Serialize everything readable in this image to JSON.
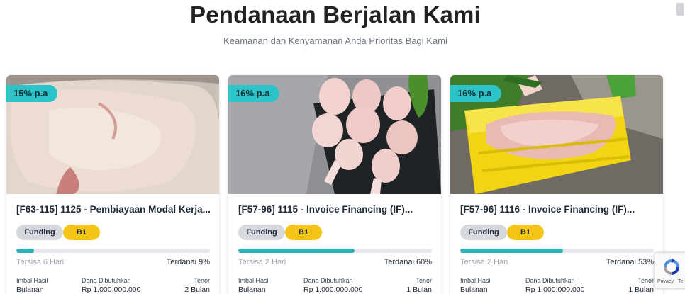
{
  "header": {
    "title": "Pendanaan Berjalan Kami",
    "subtitle": "Keamanan dan Kenyamanan Anda Prioritas Bagi Kami"
  },
  "cards": [
    {
      "rate": "15% p.a",
      "title": "[F63-115] 1125 - Pembiayaan Modal Kerja...",
      "tag_funding": "Funding",
      "tag_grade": "B1",
      "progress_percent": 9,
      "remaining": "Tersisa 6 Hari",
      "funded": "Terdanai 9%",
      "label_return": "Imbal Hasil",
      "label_needed": "Dana Dibutuhkan",
      "label_tenor": "Tenor",
      "return_value": "Bulanan",
      "needed_value": "Rp 1.000.000.000",
      "tenor_value": "2 Bulan"
    },
    {
      "rate": "16% p.a",
      "title": "[F57-96] 1115 - Invoice Financing (IF)...",
      "tag_funding": "Funding",
      "tag_grade": "B1",
      "progress_percent": 60,
      "remaining": "Tersisa 2 Hari",
      "funded": "Terdanai 60%",
      "label_return": "Imbal Hasil",
      "label_needed": "Dana Dibutuhkan",
      "label_tenor": "Tenor",
      "return_value": "Bulanan",
      "needed_value": "Rp 1.000.000.000",
      "tenor_value": "1 Bulan"
    },
    {
      "rate": "16% p.a",
      "title": "[F57-96] 1116 - Invoice Financing (IF)...",
      "tag_funding": "Funding",
      "tag_grade": "B1",
      "progress_percent": 53,
      "remaining": "Tersisa 2 Hari",
      "funded": "Terdanai 53%",
      "label_return": "Imbal Hasil",
      "label_needed": "Dana Dibutuhkan",
      "label_tenor": "Tenor",
      "return_value": "Bulanan",
      "needed_value": "Rp 1.000.000.000",
      "tenor_value": "1 Bulan"
    }
  ],
  "recaptcha": {
    "icon": "recaptcha-icon",
    "text": "Privacy - Te"
  },
  "colors": {
    "accent": "#2cc4c8",
    "progress": "#2cb0b8",
    "grade": "#f6c416",
    "funding_tag": "#d5d9de"
  }
}
